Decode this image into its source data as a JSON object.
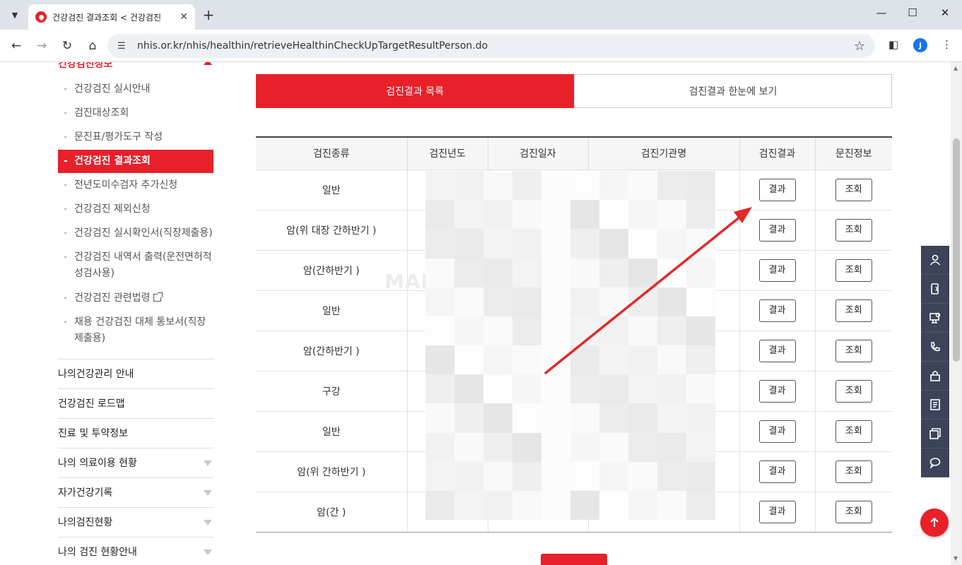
{
  "browser": {
    "tab_title": "건강검진 결과조회 < 건강검진",
    "url": "nhis.or.kr/nhis/healthin/retrieveHealthinCheckUpTargetResultPerson.do",
    "profile_initial": "J"
  },
  "sidebar": {
    "section_title": "건강검진정보",
    "sub_items": [
      {
        "label": "건강검진 실시안내"
      },
      {
        "label": "검진대상조회"
      },
      {
        "label": "문진표/평가도구 작성"
      },
      {
        "label": "건강검진 결과조회"
      },
      {
        "label": "전년도미수검자 추가신청"
      },
      {
        "label": "건강검진 제외신청"
      },
      {
        "label": "건강검진 실시확인서(직장제출용)"
      },
      {
        "label": "건강검진 내역서 출력(운전면허적성검사용)"
      },
      {
        "label": "건강검진 관련법령"
      },
      {
        "label": "채용 건강검진 대체 통보서(직장제출용)"
      }
    ],
    "main_menu": [
      {
        "label": "나의건강관리 안내"
      },
      {
        "label": "건강검진 로드맵"
      },
      {
        "label": "진료 및 투약정보"
      },
      {
        "label": "나의 의료이용 현황"
      },
      {
        "label": "자가건강기록"
      },
      {
        "label": "나의검진현황"
      },
      {
        "label": "나의 검진 현황안내"
      }
    ]
  },
  "content": {
    "tab_active": "검진결과 목록",
    "tab_inactive": "검진결과 한눈에 보기",
    "table": {
      "headers": [
        "검진종류",
        "검진년도",
        "검진일자",
        "검진기관명",
        "검진결과",
        "문진정보"
      ],
      "rows": [
        {
          "type": "일반"
        },
        {
          "type": "암(위 대장 간하반기 )"
        },
        {
          "type": "암(간하반기 )"
        },
        {
          "type": "일반"
        },
        {
          "type": "암(간하반기 )"
        },
        {
          "type": "구강"
        },
        {
          "type": "일반"
        },
        {
          "type": "암(위 간하반기 )"
        },
        {
          "type": "암(간 )"
        }
      ],
      "result_button": "결과",
      "survey_button": "조회"
    },
    "watermark": "MAN"
  },
  "colors": {
    "accent": "#e8202a",
    "quick_menu": "#3b4458"
  }
}
